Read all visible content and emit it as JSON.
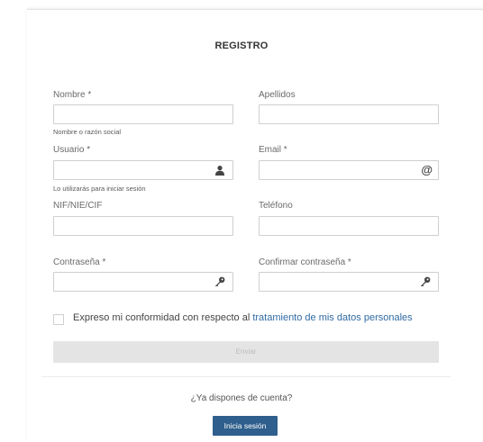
{
  "form": {
    "title": "REGISTRO",
    "fields": {
      "nombre": {
        "label": "Nombre *",
        "value": "",
        "hint": "Nombre o razón social"
      },
      "apellidos": {
        "label": "Apellidos",
        "value": ""
      },
      "usuario": {
        "label": "Usuario *",
        "value": "",
        "hint": "Lo utilizarás para iniciar sesión",
        "icon": "user-icon"
      },
      "email": {
        "label": "Email *",
        "value": "",
        "icon": "at-icon"
      },
      "nif": {
        "label": "NIF/NIE/CIF",
        "value": ""
      },
      "telefono": {
        "label": "Teléfono",
        "value": ""
      },
      "contrasena": {
        "label": "Contraseña *",
        "value": "",
        "icon": "key-icon"
      },
      "confirmar": {
        "label": "Confirmar contraseña *",
        "value": "",
        "icon": "key-icon"
      }
    },
    "consent": {
      "checked": false,
      "text": "Expreso mi conformidad con respecto al ",
      "link": "tratamiento de mis datos personales"
    },
    "submit_label": "Enviar",
    "have_account": "¿Ya dispones de cuenta?",
    "login_label": "Inicia sesión",
    "at_symbol": "@"
  },
  "colors": {
    "link": "#2f6aa3",
    "login_button": "#2f5f8c",
    "submit_disabled": "#e4e4e4",
    "field_border": "#cfcfcf"
  }
}
